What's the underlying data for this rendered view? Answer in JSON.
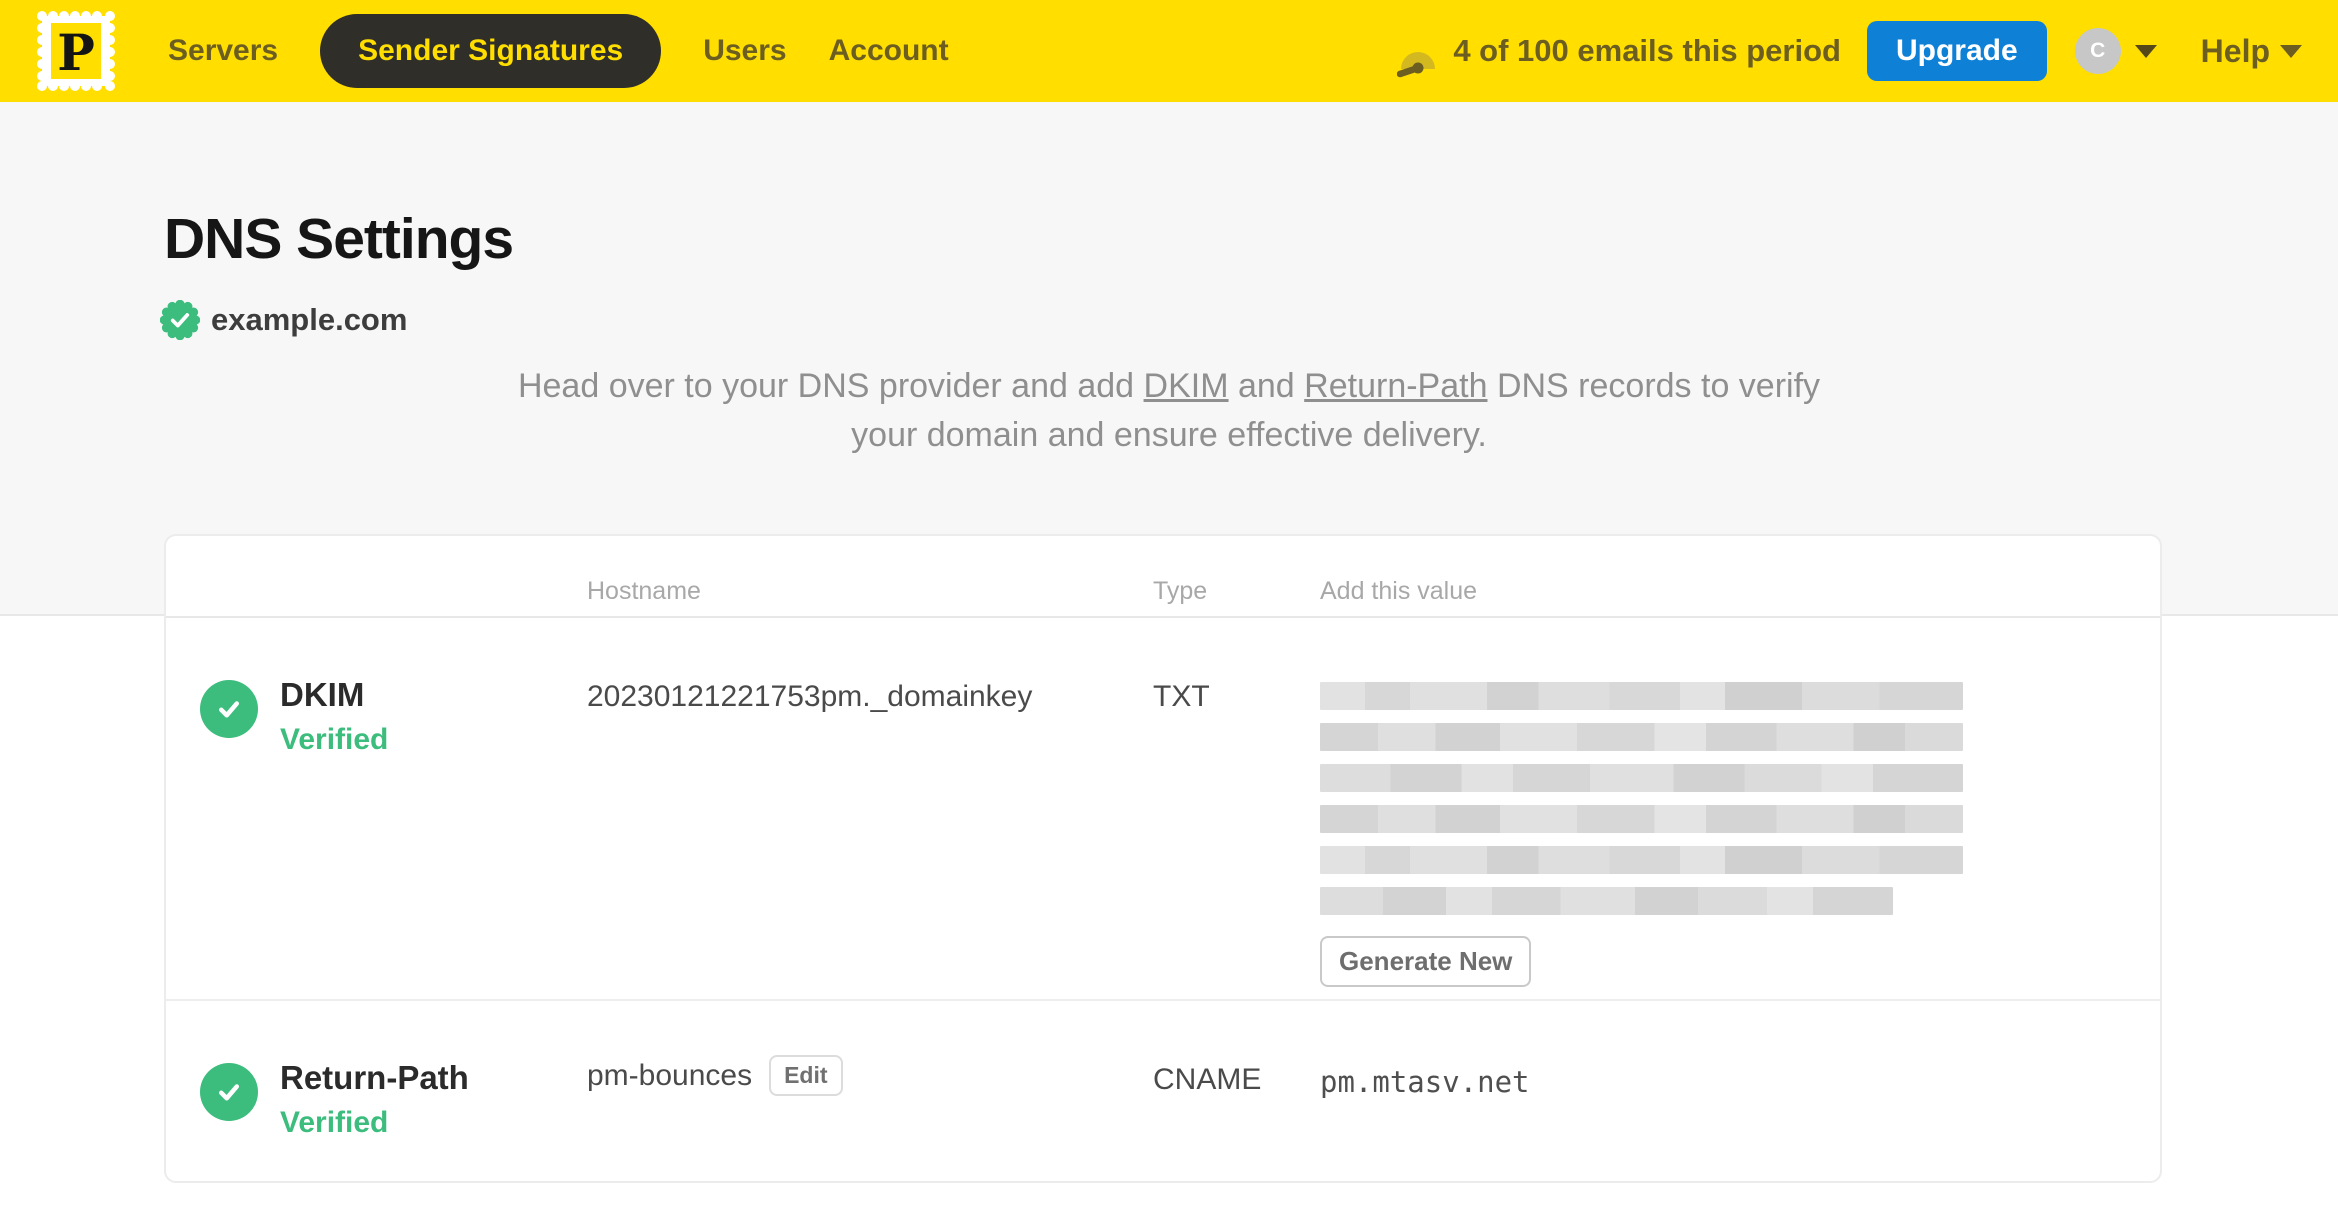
{
  "navbar": {
    "logo_letter": "P",
    "items": [
      {
        "label": "Servers",
        "active": false
      },
      {
        "label": "Sender Signatures",
        "active": true
      },
      {
        "label": "Users",
        "active": false
      },
      {
        "label": "Account",
        "active": false
      }
    ],
    "usage_text": "4 of 100 emails this period",
    "upgrade_label": "Upgrade",
    "avatar_initial": "C",
    "help_label": "Help"
  },
  "page": {
    "title": "DNS Settings",
    "domain": "example.com",
    "domain_status": "verified",
    "description": {
      "part1": "Head over to your DNS provider and add ",
      "link_dkim": "DKIM",
      "part2": " and ",
      "link_return_path": "Return-Path",
      "part3": " DNS records to verify your domain and ensure effective delivery."
    }
  },
  "dns_table": {
    "headers": {
      "hostname": "Hostname",
      "type": "Type",
      "value": "Add this value"
    },
    "rows": [
      {
        "name": "DKIM",
        "status": "Verified",
        "hostname": "20230121221753pm._domainkey",
        "type": "TXT",
        "value_redacted": true,
        "action_label": "Generate New"
      },
      {
        "name": "Return-Path",
        "status": "Verified",
        "hostname": "pm-bounces",
        "edit_label": "Edit",
        "type": "CNAME",
        "value": "pm.mtasv.net"
      }
    ]
  },
  "colors": {
    "brand_yellow": "#FFDE00",
    "nav_active_bg": "#302E29",
    "nav_text": "#6B5E20",
    "upgrade_blue": "#0E81D7",
    "verified_green": "#3DBD7D"
  }
}
